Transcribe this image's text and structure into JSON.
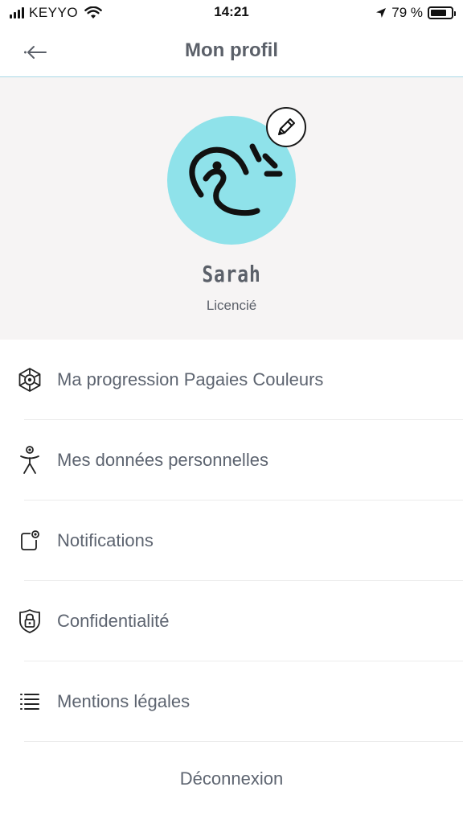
{
  "status_bar": {
    "carrier": "KEYYO",
    "time": "14:21",
    "battery": "79 %",
    "battery_level": 0.79
  },
  "header": {
    "title": "Mon profil"
  },
  "profile": {
    "name": "Sarah",
    "status": "Licencié",
    "avatar_color": "#8fe2ea"
  },
  "menu": {
    "items": [
      {
        "label": "Ma progression Pagaies Couleurs",
        "icon": "hexagon-target-icon"
      },
      {
        "label": "Mes données personnelles",
        "icon": "person-icon"
      },
      {
        "label": "Notifications",
        "icon": "notification-icon"
      },
      {
        "label": "Confidentialité",
        "icon": "shield-lock-icon"
      },
      {
        "label": "Mentions légales",
        "icon": "list-icon"
      }
    ]
  },
  "logout_label": "Déconnexion",
  "colors": {
    "accent_line": "#a9d9e6",
    "text": "#5d6470",
    "profile_bg": "#f6f4f4"
  }
}
